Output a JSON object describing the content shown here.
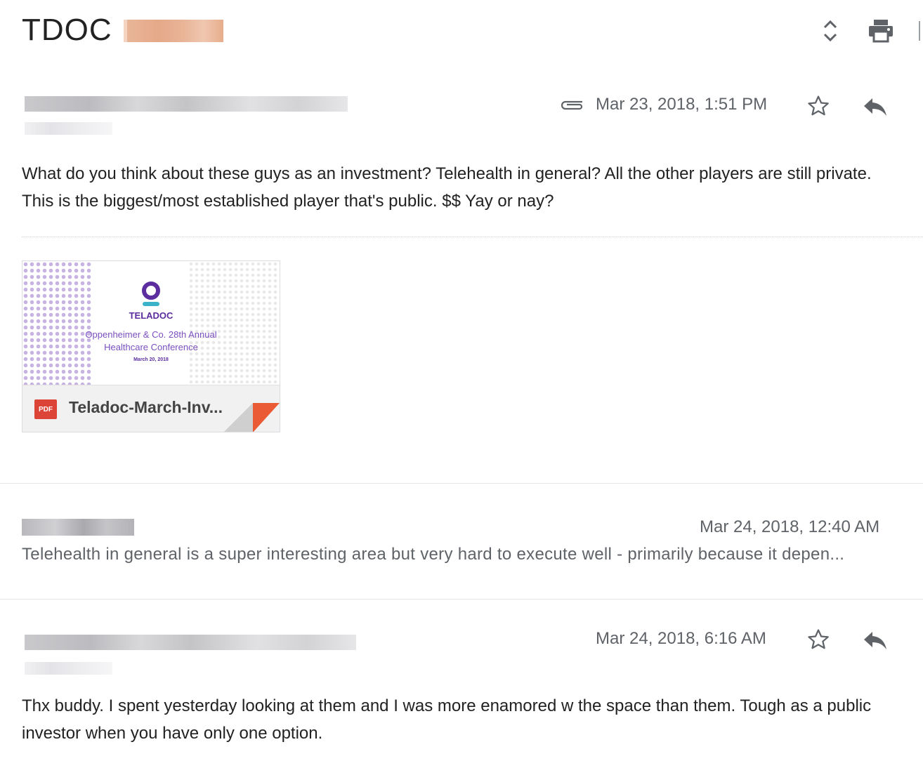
{
  "subject": "TDOC",
  "icons": {
    "expand": "unfold-more-icon",
    "print": "print-icon",
    "attachment": "paperclip-icon",
    "star": "star-outline-icon",
    "reply": "reply-icon",
    "pdf": "pdf-icon"
  },
  "messages": [
    {
      "date": "Mar 23, 2018, 1:51 PM",
      "body": "What do you think about these guys as an investment? Telehealth in general? All the other players are still private. This is the biggest/most established player that's public. $$ Yay or nay?",
      "attachment": {
        "brand": "TELADOC",
        "line1": "Oppenheimer & Co. 28th Annual",
        "line2": "Healthcare Conference",
        "line3": "March 20, 2018",
        "badge": "PDF",
        "name": "Teladoc-March-Inv..."
      }
    },
    {
      "date": "Mar 24, 2018, 12:40 AM",
      "snippet": "Telehealth in general is a super interesting area but very hard to execute well - primarily because it depen..."
    },
    {
      "date": "Mar 24, 2018, 6:16 AM",
      "body": "Thx buddy. I spent yesterday looking at them and I was more enamored w the space than them. Tough as a public investor when you have only one option."
    }
  ],
  "colors": {
    "pdf_red": "#db4437",
    "teladoc_purple": "#5b2d9e",
    "teladoc_teal": "#3ab3c9"
  }
}
